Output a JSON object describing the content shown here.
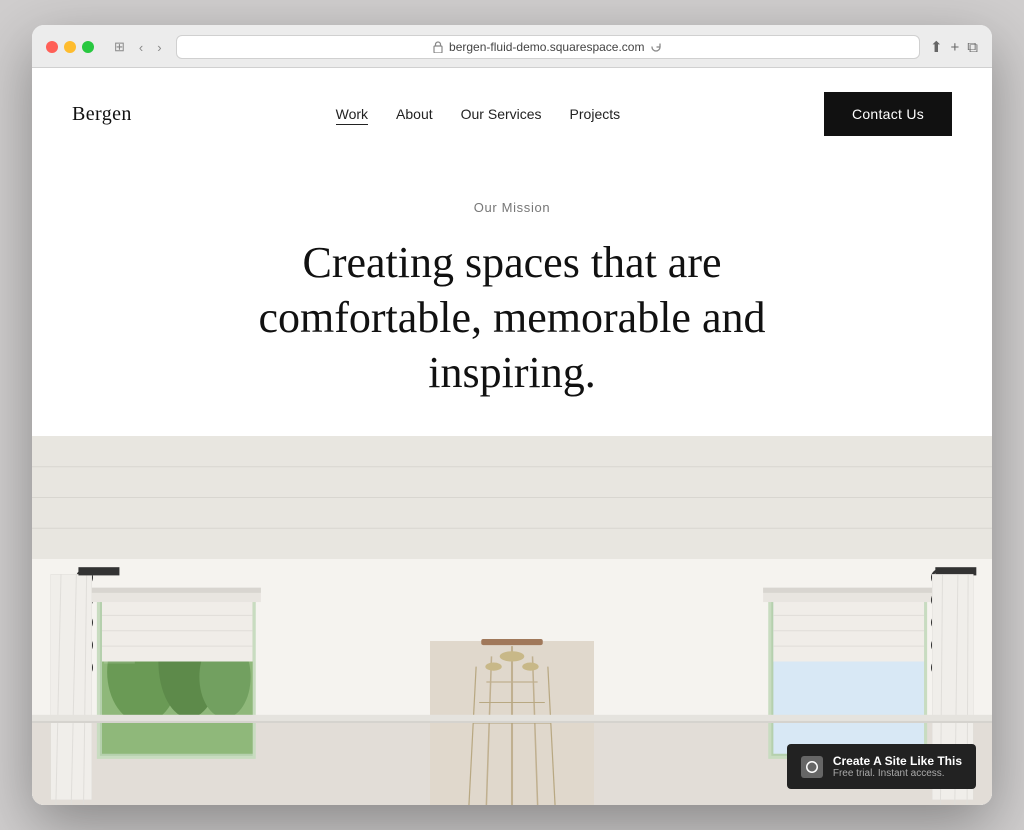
{
  "browser": {
    "url": "bergen-fluid-demo.squarespace.com",
    "controls": {
      "back": "‹",
      "forward": "›"
    }
  },
  "nav": {
    "logo": "Bergen",
    "links": [
      {
        "label": "Work",
        "active": true
      },
      {
        "label": "About",
        "active": false
      },
      {
        "label": "Our Services",
        "active": false
      },
      {
        "label": "Projects",
        "active": false
      }
    ],
    "cta": "Contact Us"
  },
  "hero": {
    "subtitle": "Our Mission",
    "title": "Creating spaces that are comfortable, memorable and inspiring."
  },
  "badge": {
    "title": "Create A Site Like This",
    "subtitle": "Free trial. Instant access."
  }
}
